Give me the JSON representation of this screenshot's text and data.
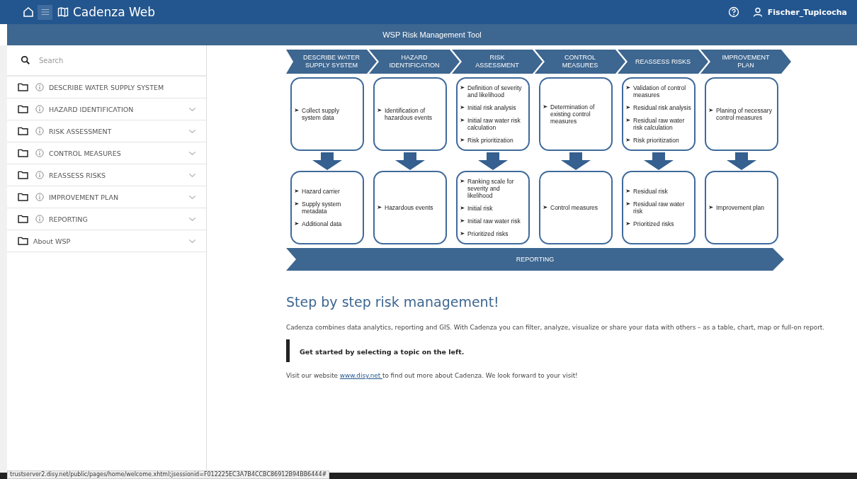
{
  "header": {
    "app_title": "Cadenza Web",
    "user": "Fischer_Tupicocha"
  },
  "subheader": {
    "title": "WSP Risk Management Tool"
  },
  "sidebar": {
    "search": {
      "placeholder": "Search"
    },
    "items": [
      {
        "label": "DESCRIBE WATER SUPPLY SYSTEM",
        "info": true,
        "expandable": false
      },
      {
        "label": "HAZARD IDENTIFICATION",
        "info": true,
        "expandable": true
      },
      {
        "label": "RISK ASSESSMENT",
        "info": true,
        "expandable": true
      },
      {
        "label": "CONTROL MEASURES",
        "info": true,
        "expandable": true
      },
      {
        "label": "REASSESS RISKS",
        "info": true,
        "expandable": true
      },
      {
        "label": "IMPROVEMENT PLAN",
        "info": true,
        "expandable": true
      },
      {
        "label": "REPORTING",
        "info": true,
        "expandable": true
      },
      {
        "label": "About WSP",
        "info": false,
        "expandable": true
      }
    ]
  },
  "diagram": {
    "steps": [
      {
        "title": "DESCRIBE WATER SUPPLY SYSTEM",
        "tasks": [
          "Collect supply system data"
        ],
        "outputs": [
          "Hazard carrier",
          "Supply system metadata",
          "Additional data"
        ]
      },
      {
        "title": "HAZARD IDENTIFICATION",
        "tasks": [
          "Identification of hazardous events"
        ],
        "outputs": [
          "Hazardous events"
        ]
      },
      {
        "title": "RISK ASSESSMENT",
        "tasks": [
          "Definition of severity and likelihood",
          "Initial risk analysis",
          "Initial raw water risk calculation",
          "Risk prioritization"
        ],
        "outputs": [
          "Ranking scale for severity and likelihood",
          "Initial risk",
          "Initial raw water risk",
          "Prioritized risks"
        ]
      },
      {
        "title": "CONTROL MEASURES",
        "tasks": [
          "Determination of existing control measures"
        ],
        "outputs": [
          "Control measures"
        ]
      },
      {
        "title": "REASSESS RISKS",
        "tasks": [
          "Validation of control measures",
          "Residual risk analysis",
          "Residual raw water risk calculation",
          "Risk prioritization"
        ],
        "outputs": [
          "Residual risk",
          "Residual raw water risk",
          "Prioritized risks"
        ]
      },
      {
        "title": "IMPROVEMENT PLAN",
        "tasks": [
          "Planing of necessary control measures"
        ],
        "outputs": [
          "Improvement plan"
        ]
      }
    ],
    "reporting": "REPORTING"
  },
  "content": {
    "heading": "Step by step risk management!",
    "intro": "Cadenza combines data analytics, reporting and GIS. With Cadenza you can filter, analyze, visualize or share your data with others – as a table, chart, map or full-on report.",
    "callout": "Get started by selecting a topic on the left.",
    "visit": {
      "before": "Visit our website ",
      "link": "www.disy.net ",
      "after": "to find out more about Cadenza. We look forward to your visit!"
    }
  },
  "status_url": "trustserver2.disy.net/public/pages/home/welcome.xhtml;jsessionid=F012225EC3A7B4CCBC86912B94BB6444#"
}
